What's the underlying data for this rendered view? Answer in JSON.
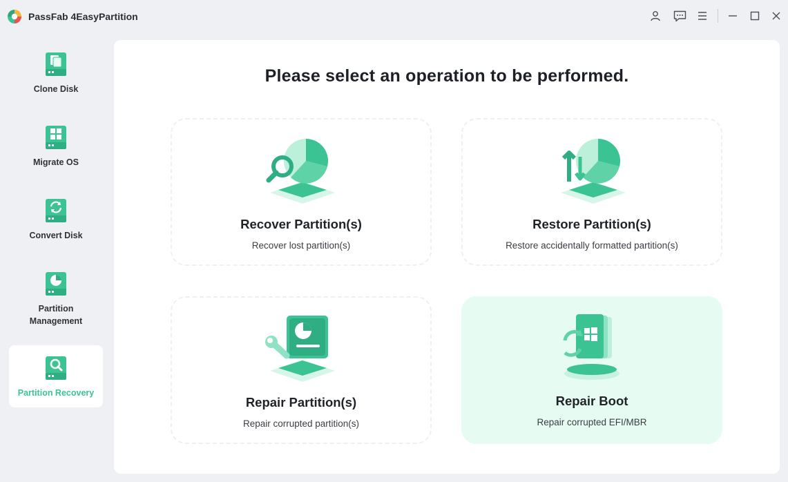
{
  "app": {
    "title": "PassFab 4EasyPartition"
  },
  "titlebar": {
    "icons": [
      "user-icon",
      "feedback-icon",
      "menu-icon",
      "minimize-icon",
      "maximize-icon",
      "close-icon"
    ]
  },
  "sidebar": {
    "items": [
      {
        "label": "Clone Disk",
        "icon": "clone-disk-icon",
        "active": false
      },
      {
        "label": "Migrate OS",
        "icon": "migrate-os-icon",
        "active": false
      },
      {
        "label": "Convert Disk",
        "icon": "convert-disk-icon",
        "active": false
      },
      {
        "label": "Partition Management",
        "icon": "partition-management-icon",
        "active": false
      },
      {
        "label": "Partition Recovery",
        "icon": "partition-recovery-icon",
        "active": true
      }
    ]
  },
  "main": {
    "heading": "Please select an operation to be performed.",
    "cards": [
      {
        "title": "Recover Partition(s)",
        "desc": "Recover lost partition(s)",
        "icon": "recover-partition-icon",
        "selected": false
      },
      {
        "title": "Restore Partition(s)",
        "desc": "Restore accidentally formatted partition(s)",
        "icon": "restore-partition-icon",
        "selected": false
      },
      {
        "title": "Repair Partition(s)",
        "desc": "Repair corrupted partition(s)",
        "icon": "repair-partition-icon",
        "selected": false
      },
      {
        "title": "Repair Boot",
        "desc": "Repair corrupted EFI/MBR",
        "icon": "repair-boot-icon",
        "selected": true
      }
    ]
  },
  "colors": {
    "accent": "#3cc394",
    "accent_light": "#e6fbf1",
    "background": "#eef0f4"
  }
}
